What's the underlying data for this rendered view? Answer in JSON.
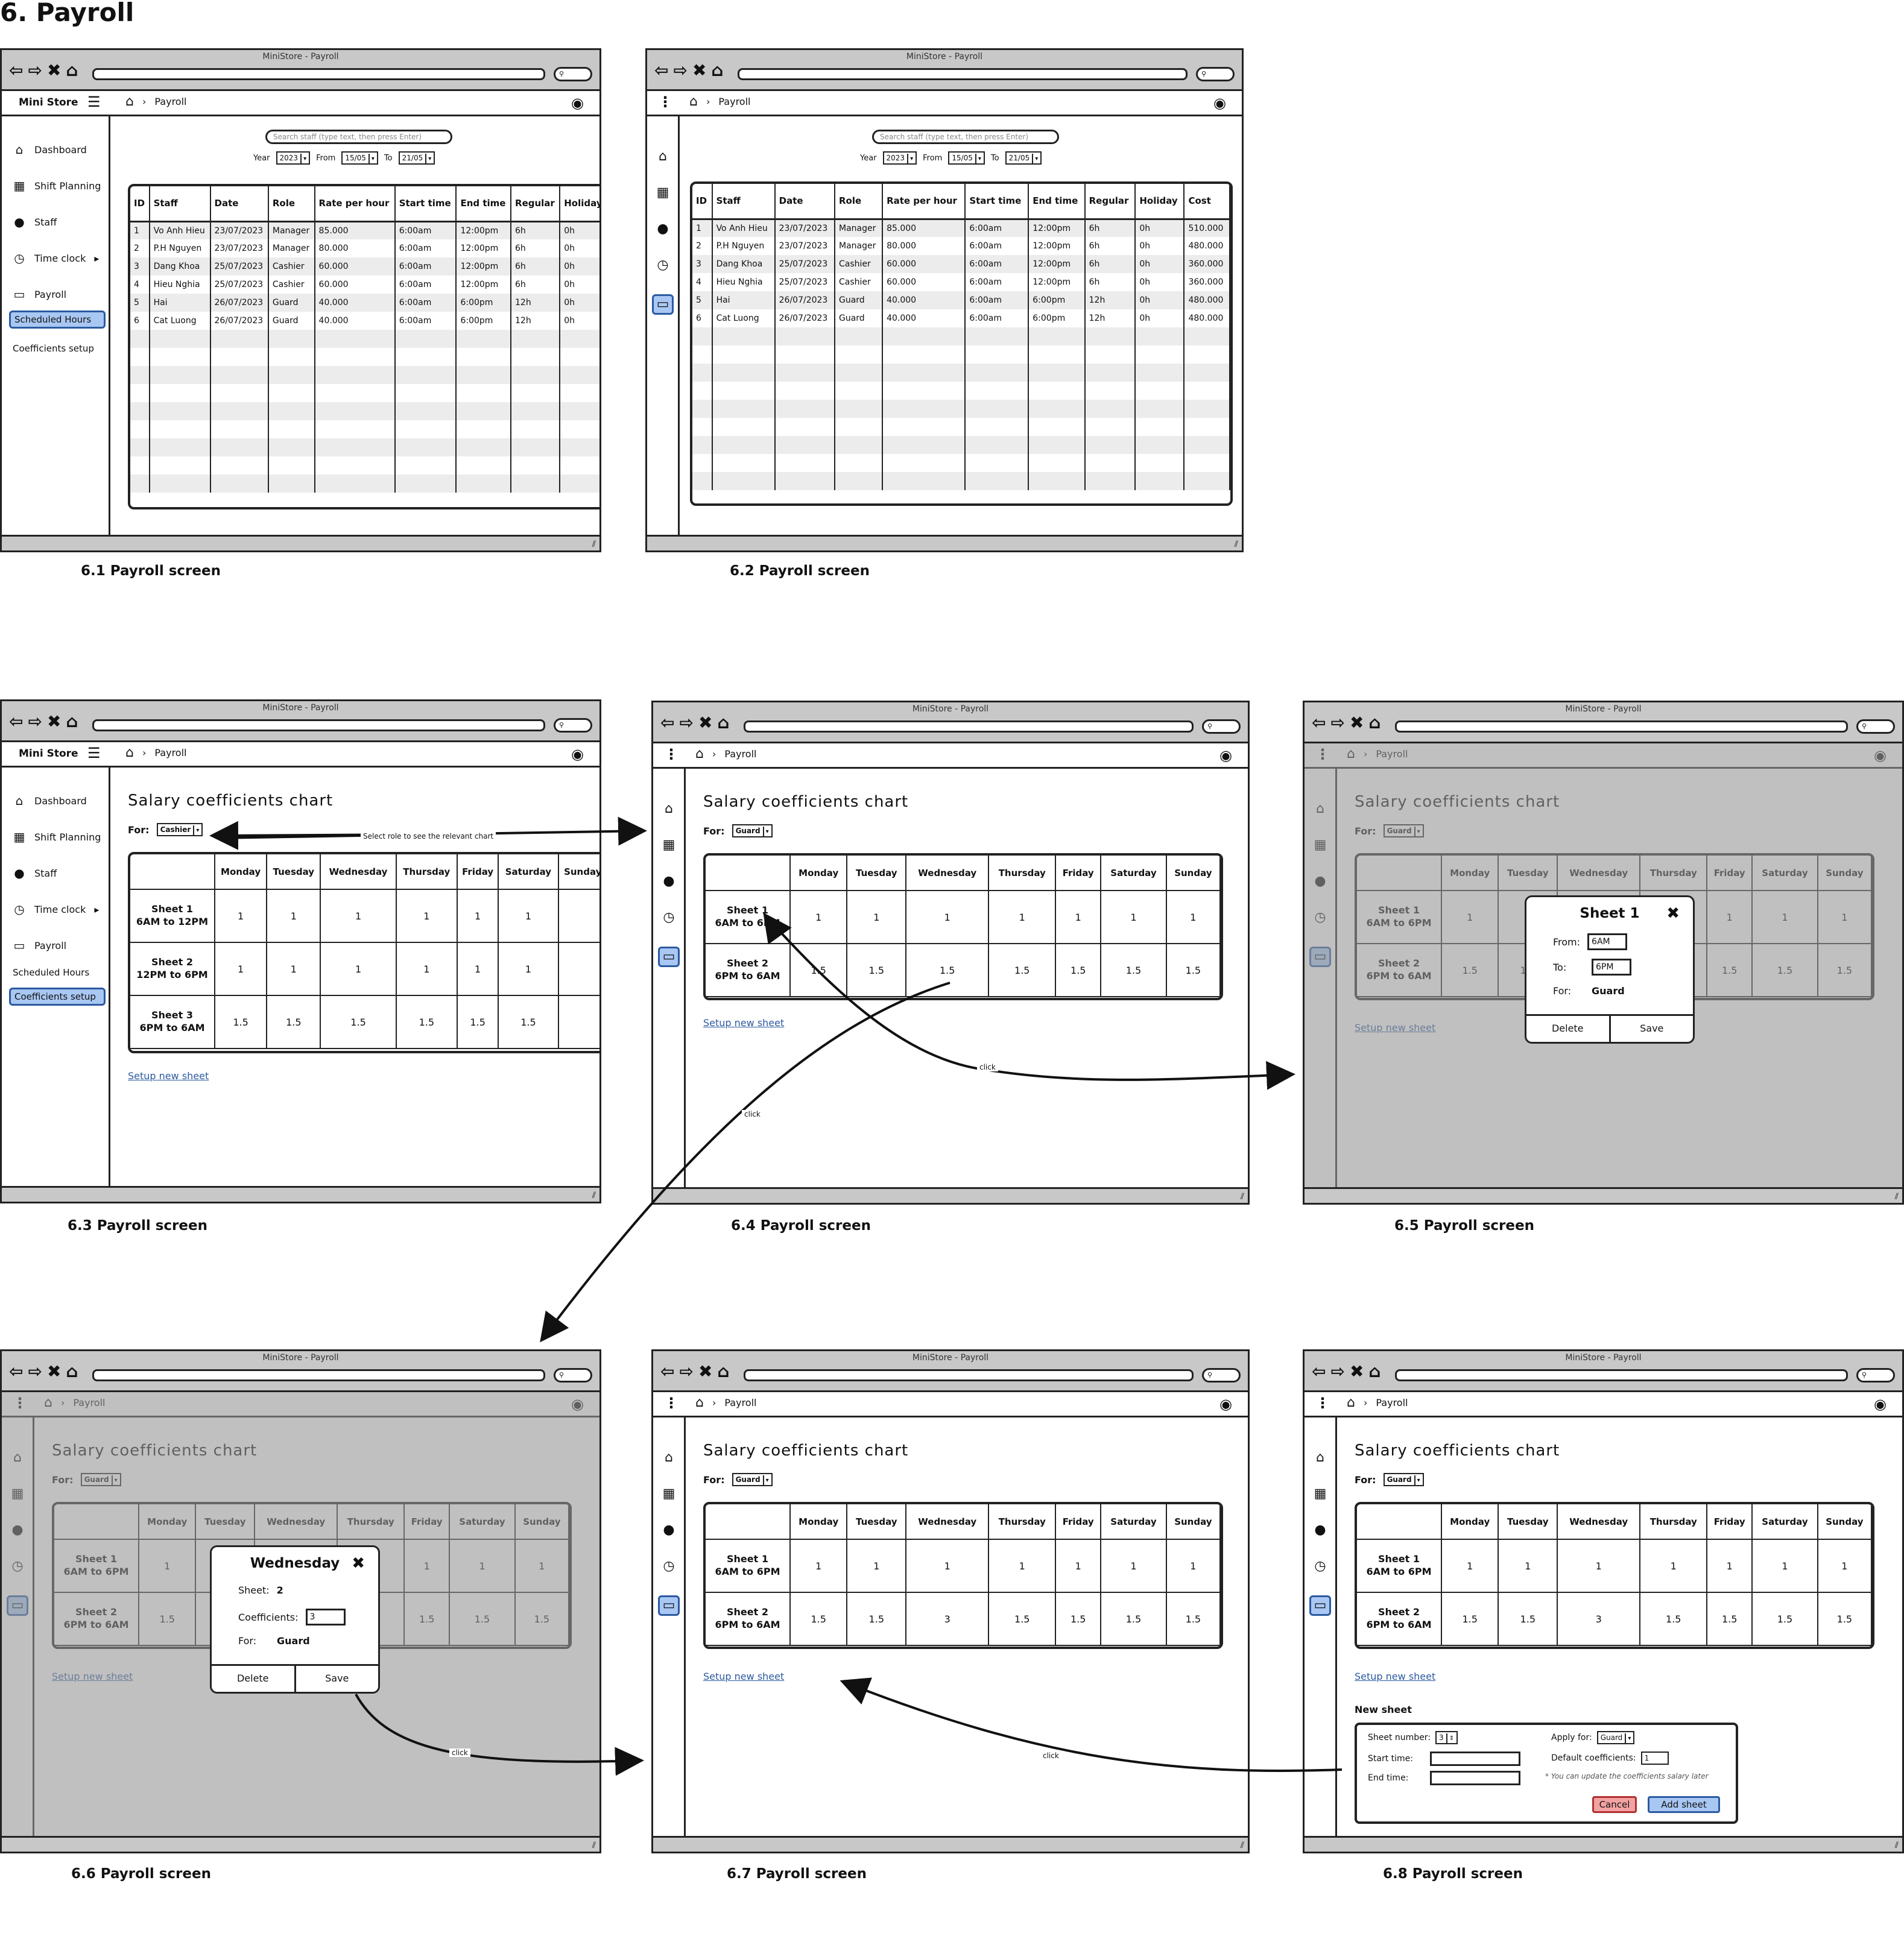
{
  "page_title": "6. Payroll",
  "window_title": "MiniStore - Payroll",
  "brand": "Mini Store",
  "breadcrumb": "Payroll",
  "sidebar": {
    "dashboard": "Dashboard",
    "shift": "Shift Planning",
    "staff": "Staff",
    "timeclock": "Time clock",
    "payroll": "Payroll",
    "scheduled": "Scheduled Hours",
    "coefficients": "Coefficients setup"
  },
  "filters": {
    "search_placeholder": "Search staff (type text, then press Enter)",
    "year_label": "Year",
    "year": "2023",
    "from_label": "From",
    "from": "15/05",
    "to_label": "To",
    "to": "21/05"
  },
  "payroll_columns": [
    "ID",
    "Staff",
    "Date",
    "Role",
    "Rate per hour",
    "Start time",
    "End time",
    "Regular",
    "Holiday",
    "Cost"
  ],
  "payroll_rows": [
    [
      "1",
      "Vo Anh Hieu",
      "23/07/2023",
      "Manager",
      "85.000",
      "6:00am",
      "12:00pm",
      "6h",
      "0h",
      "510.000"
    ],
    [
      "2",
      "P.H Nguyen",
      "23/07/2023",
      "Manager",
      "80.000",
      "6:00am",
      "12:00pm",
      "6h",
      "0h",
      "480.000"
    ],
    [
      "3",
      "Dang Khoa",
      "25/07/2023",
      "Cashier",
      "60.000",
      "6:00am",
      "12:00pm",
      "6h",
      "0h",
      "360.000"
    ],
    [
      "4",
      "Hieu Nghia",
      "25/07/2023",
      "Cashier",
      "60.000",
      "6:00am",
      "12:00pm",
      "6h",
      "0h",
      "360.000"
    ],
    [
      "5",
      "Hai",
      "26/07/2023",
      "Guard",
      "40.000",
      "6:00am",
      "6:00pm",
      "12h",
      "0h",
      "480.000"
    ],
    [
      "6",
      "Cat Luong",
      "26/07/2023",
      "Guard",
      "40.000",
      "6:00am",
      "6:00pm",
      "12h",
      "0h",
      "480.000"
    ]
  ],
  "chart": {
    "title": "Salary coefficients chart",
    "for_label": "For:",
    "role_cashier": "Cashier",
    "role_guard": "Guard",
    "days": [
      "Monday",
      "Tuesday",
      "Wednesday",
      "Thursday",
      "Friday",
      "Saturday",
      "Sunday"
    ],
    "cashier_sheets": [
      {
        "name": "Sheet 1",
        "time": "6AM to 12PM",
        "values": [
          "1",
          "1",
          "1",
          "1",
          "1",
          "1"
        ]
      },
      {
        "name": "Sheet 2",
        "time": "12PM to 6PM",
        "values": [
          "1",
          "1",
          "1",
          "1",
          "1",
          "1"
        ]
      },
      {
        "name": "Sheet 3",
        "time": "6PM to 6AM",
        "values": [
          "1.5",
          "1.5",
          "1.5",
          "1.5",
          "1.5",
          "1.5"
        ]
      }
    ],
    "guard_sheets": [
      {
        "name": "Sheet 1",
        "time": "6AM to 6PM",
        "values": [
          "1",
          "1",
          "1",
          "1",
          "1",
          "1",
          "1"
        ]
      },
      {
        "name": "Sheet 2",
        "time": "6PM to 6AM",
        "values": [
          "1.5",
          "1.5",
          "1.5",
          "1.5",
          "1.5",
          "1.5",
          "1.5"
        ]
      }
    ],
    "guard_sheets_updated": [
      {
        "name": "Sheet 1",
        "time": "6AM to 6PM",
        "values": [
          "1",
          "1",
          "1",
          "1",
          "1",
          "1",
          "1"
        ]
      },
      {
        "name": "Sheet 2",
        "time": "6PM to 6AM",
        "values": [
          "1.5",
          "1.5",
          "3",
          "1.5",
          "1.5",
          "1.5",
          "1.5"
        ]
      }
    ],
    "setup_link": "Setup new sheet",
    "select_role_hint": "Select role to see the relevant chart",
    "click_label": "click"
  },
  "modal_sheet": {
    "title": "Sheet 1",
    "from_label": "From:",
    "from": "6AM",
    "to_label": "To:",
    "to": "6PM",
    "for_label": "For:",
    "for": "Guard",
    "delete": "Delete",
    "save": "Save"
  },
  "modal_day": {
    "title": "Wednesday",
    "sheet_label": "Sheet:",
    "sheet": "2",
    "coef_label": "Coefficients:",
    "coef": "3",
    "for_label": "For:",
    "for": "Guard",
    "delete": "Delete",
    "save": "Save"
  },
  "new_sheet": {
    "heading": "New sheet",
    "sheet_number_label": "Sheet number:",
    "sheet_number": "3",
    "start_label": "Start time:",
    "end_label": "End time:",
    "apply_label": "Apply for:",
    "apply": "Guard",
    "default_coef_label": "Default coefficients:",
    "default_coef": "1",
    "note": "* You can update the coefficients salary later",
    "cancel": "Cancel",
    "add": "Add sheet"
  },
  "captions": [
    "6.1 Payroll screen",
    "6.2 Payroll screen",
    "6.3 Payroll screen",
    "6.4 Payroll screen",
    "6.5 Payroll screen",
    "6.6 Payroll screen",
    "6.7 Payroll screen",
    "6.8 Payroll screen"
  ]
}
